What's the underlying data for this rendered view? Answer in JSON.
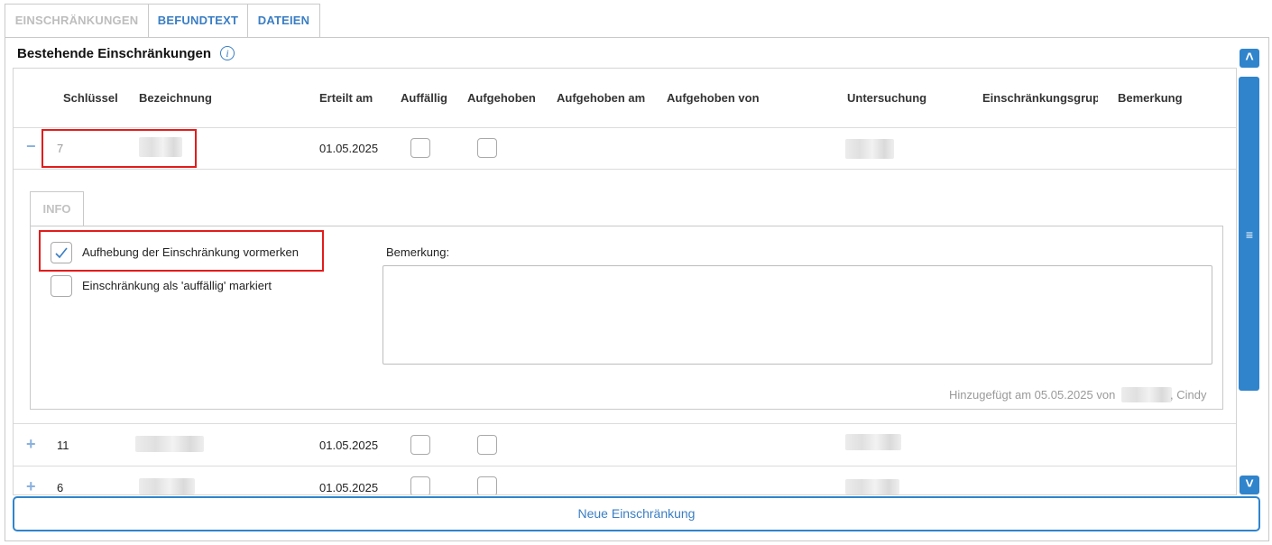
{
  "tabs": [
    {
      "label": "EINSCHRÄNKUNGEN",
      "state": "inactive"
    },
    {
      "label": "BEFUNDTEXT",
      "state": "active"
    },
    {
      "label": "DATEIEN",
      "state": "active"
    }
  ],
  "section": {
    "title": "Bestehende Einschränkungen",
    "info_icon": "i"
  },
  "columns": [
    "Schlüssel",
    "Bezeichnung",
    "Erteilt am",
    "Auffällig",
    "Aufgehoben",
    "Aufgehoben am",
    "Aufgehoben von",
    "Untersuchung",
    "Einschränkungsgrup",
    "Bemerkung"
  ],
  "rows": [
    {
      "toggle": "−",
      "key": "7",
      "erteilt_am": "01.05.2025",
      "auffaellig": false,
      "aufgehoben": false,
      "expanded": true
    },
    {
      "toggle": "+",
      "key": "11",
      "erteilt_am": "01.05.2025",
      "auffaellig": false,
      "aufgehoben": false,
      "expanded": false
    },
    {
      "toggle": "+",
      "key": "6",
      "erteilt_am": "01.05.2025",
      "auffaellig": false,
      "aufgehoben": false,
      "expanded": false
    }
  ],
  "detail": {
    "tab_label": "INFO",
    "checkbox_aufhebung": {
      "label": "Aufhebung der Einschränkung vormerken",
      "checked": true
    },
    "checkbox_auffaellig": {
      "label": "Einschränkung als 'auffällig' markiert",
      "checked": false
    },
    "bemerkung_label": "Bemerkung:",
    "bemerkung_value": "",
    "footer_prefix": "Hinzugefügt am 05.05.2025 von",
    "footer_suffix": ", Cindy"
  },
  "scrollbar": {
    "up_glyph": "˄",
    "down_glyph": "˅",
    "grip_glyph": "≡"
  },
  "actions": {
    "new_button": "Neue Einschränkung"
  },
  "colors": {
    "accent": "#2f84cc",
    "highlight": "#e21c1c"
  }
}
